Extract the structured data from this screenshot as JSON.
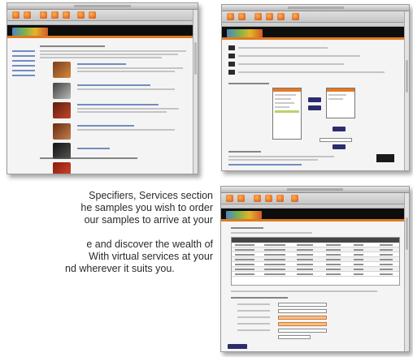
{
  "text_lines": [
    "Specifiers, Services section",
    "he samples you wish to order",
    "our samples to arrive at your",
    "e and discover the wealth of",
    "With virtual services at your",
    "nd wherever it suits you."
  ],
  "colors": {
    "accent": "#e07a1e",
    "banner": "#0d0d0d",
    "text": "#2a2a2a"
  },
  "screenshots": [
    {
      "name": "samples-page"
    },
    {
      "name": "order-form-page"
    },
    {
      "name": "order-status-page"
    }
  ],
  "icons": {
    "toolbar_button": "toolbar-button-icon",
    "product_thumbnail": "product-thumbnail-icon",
    "logo": "brand-logo-icon"
  }
}
